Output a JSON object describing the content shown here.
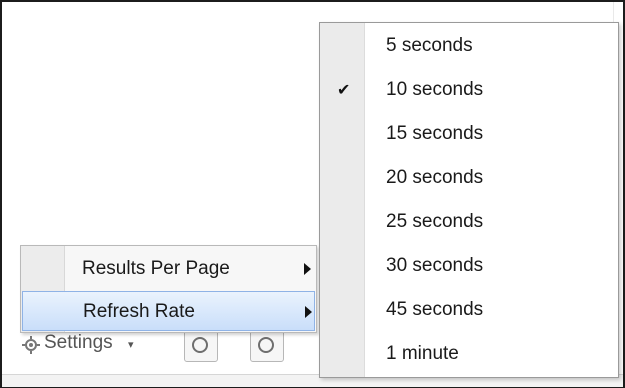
{
  "toolbar": {
    "settings_label": "Settings",
    "settings_icon": "gear-icon",
    "caret": "▾"
  },
  "menu": {
    "items": [
      {
        "label": "Results Per Page",
        "has_submenu": true,
        "highlighted": false
      },
      {
        "label": "Refresh Rate",
        "has_submenu": true,
        "highlighted": true
      }
    ]
  },
  "submenu": {
    "items": [
      {
        "label": "5 seconds",
        "checked": false
      },
      {
        "label": "10 seconds",
        "checked": true
      },
      {
        "label": "15 seconds",
        "checked": false
      },
      {
        "label": "20 seconds",
        "checked": false
      },
      {
        "label": "25 seconds",
        "checked": false
      },
      {
        "label": "30 seconds",
        "checked": false
      },
      {
        "label": "45 seconds",
        "checked": false
      },
      {
        "label": "1 minute",
        "checked": false
      }
    ],
    "check_glyph": "✔"
  },
  "colors": {
    "highlight_border": "#8fb3e6",
    "highlight_fill": "#c9defa"
  }
}
